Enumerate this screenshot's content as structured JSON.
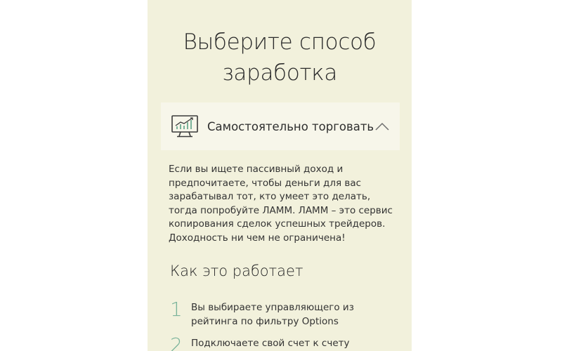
{
  "page": {
    "title": "Выберите способ заработка"
  },
  "accordion": {
    "label": "Самостоятельно торговать",
    "icon": "trading-monitor-icon",
    "chevron": "chevron-up-icon",
    "accent_color": "#7ab39a"
  },
  "description": "Если вы ищете пассивный доход и предпочитаете, чтобы деньги для вас зарабатывал тот, кто умеет это делать, тогда попробуйте ЛАММ. ЛАММ – это сервис копирования сделок успешных трейдеров. Доходность ни чем не ограничена!",
  "how_it_works": {
    "title": "Как это работает",
    "steps": [
      {
        "number": "1",
        "text": "Вы выбираете управляющего из рейтинга по фильтру Options"
      },
      {
        "number": "2",
        "text": "Подключаете свой счет к счету"
      }
    ]
  }
}
